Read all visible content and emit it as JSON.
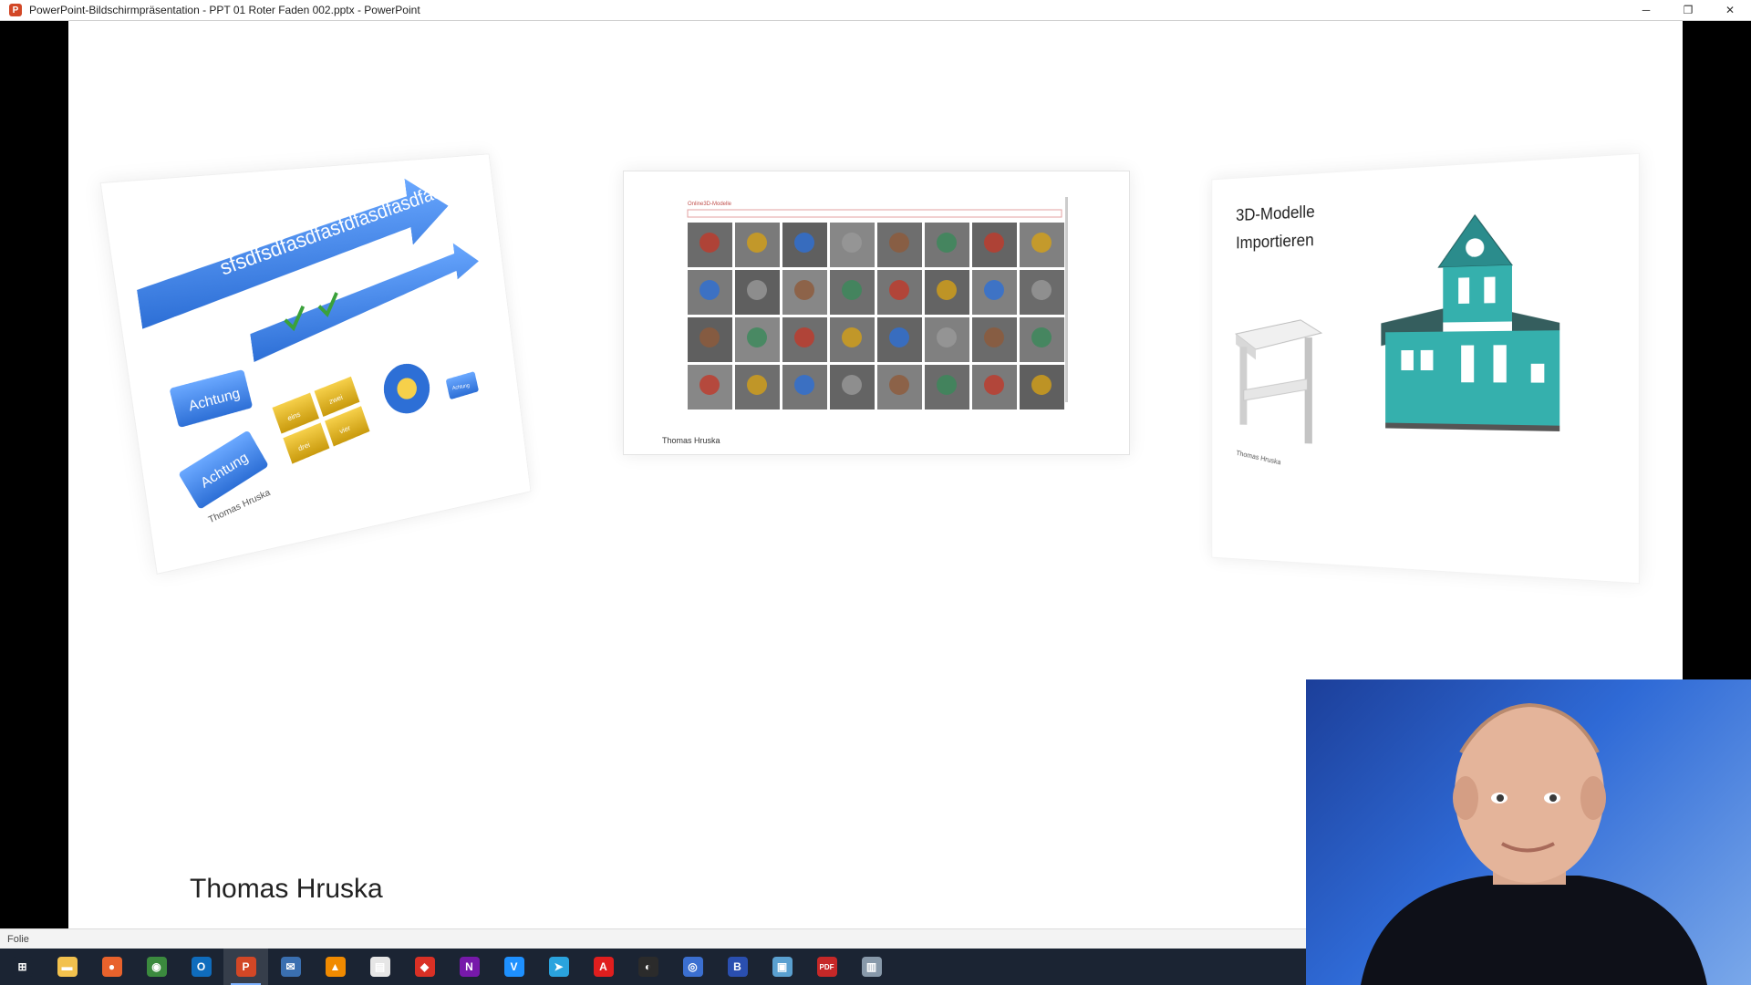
{
  "window": {
    "title": "PowerPoint-Bildschirmpräsentation  -  PPT 01 Roter Faden 002.pptx - PowerPoint",
    "app_icon_letter": "P",
    "controls": {
      "minimize": "─",
      "restore": "❐",
      "close": "✕"
    }
  },
  "slide": {
    "left_panel": {
      "arrow_text": "sfsdfsdfasdfasfdfasdfasdfasdfasfd",
      "labels": [
        "Achtung",
        "Achtung",
        "Achtung"
      ],
      "grid_labels": [
        "eins",
        "zwei",
        "drei",
        "vier"
      ],
      "author": "Thomas Hruska"
    },
    "middle_panel": {
      "dialog_title": "Online3D-Modelle",
      "author": "Thomas Hruska"
    },
    "right_panel": {
      "title_line1": "3D-Modelle",
      "title_line2": "Importieren",
      "author": "Thomas Hruska"
    },
    "footer_name": "Thomas Hruska"
  },
  "statusbar": {
    "label": "Folie"
  },
  "taskbar": {
    "items": [
      {
        "name": "start-button",
        "glyph": "⊞",
        "color": "#1b2433"
      },
      {
        "name": "file-explorer-icon",
        "glyph": "▬",
        "color": "#f2c14e"
      },
      {
        "name": "firefox-icon",
        "glyph": "●",
        "color": "#e8622c"
      },
      {
        "name": "chrome-icon",
        "glyph": "◉",
        "color": "#3b8a3e"
      },
      {
        "name": "outlook-icon",
        "glyph": "O",
        "color": "#0f6cbd"
      },
      {
        "name": "powerpoint-icon",
        "glyph": "P",
        "color": "#d24726"
      },
      {
        "name": "thunderbird-icon",
        "glyph": "✉",
        "color": "#3a6fb0"
      },
      {
        "name": "vlc-icon",
        "glyph": "▲",
        "color": "#f08a00"
      },
      {
        "name": "office-icon",
        "glyph": "▤",
        "color": "#e6e6e6"
      },
      {
        "name": "lips-app-icon",
        "glyph": "◆",
        "color": "#d93025"
      },
      {
        "name": "onenote-icon",
        "glyph": "N",
        "color": "#7719aa"
      },
      {
        "name": "v-app-icon",
        "glyph": "V",
        "color": "#1e90ff"
      },
      {
        "name": "telegram-icon",
        "glyph": "➤",
        "color": "#2aa3de"
      },
      {
        "name": "acrobat-icon",
        "glyph": "A",
        "color": "#e01e1e"
      },
      {
        "name": "obs-icon",
        "glyph": "◐",
        "color": "#2b2b2b"
      },
      {
        "name": "record-app-icon",
        "glyph": "◎",
        "color": "#3b6fd0"
      },
      {
        "name": "blue-app-icon",
        "glyph": "B",
        "color": "#2a4fb0"
      },
      {
        "name": "monitor-app-icon",
        "glyph": "▣",
        "color": "#5aa0d0"
      },
      {
        "name": "pdf-app-icon",
        "glyph": "PDF",
        "color": "#c62828"
      },
      {
        "name": "device-app-icon",
        "glyph": "▥",
        "color": "#8899aa"
      }
    ],
    "active_index": 5
  }
}
